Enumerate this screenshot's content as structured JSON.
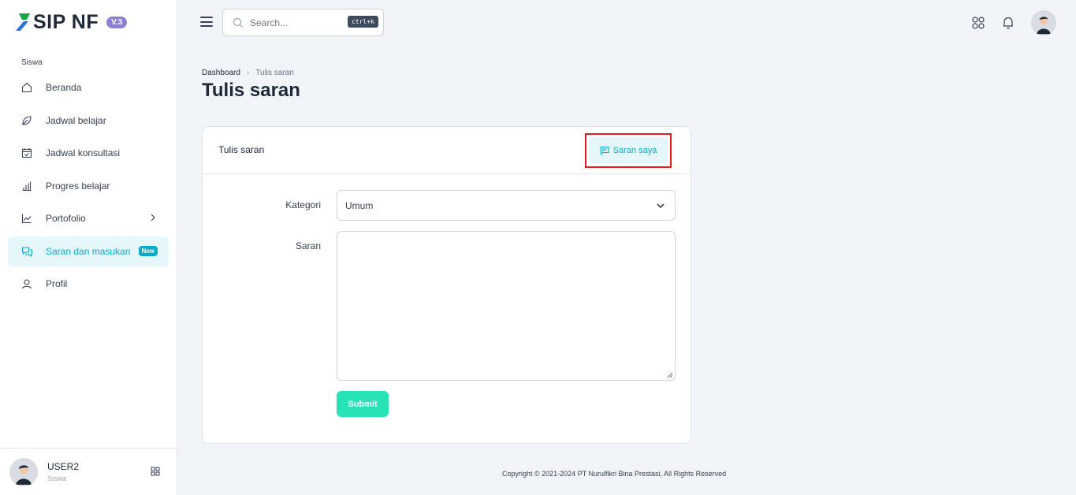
{
  "brand": {
    "name": "SIP NF",
    "version": "V.3"
  },
  "sidebar": {
    "section_label": "Siswa",
    "items": [
      {
        "label": "Beranda",
        "icon": "home-icon"
      },
      {
        "label": "Jadwal belajar",
        "icon": "leaf-icon"
      },
      {
        "label": "Jadwal konsultasi",
        "icon": "calendar-check-icon"
      },
      {
        "label": "Progres belajar",
        "icon": "bar-chart-icon"
      },
      {
        "label": "Portofolio",
        "icon": "trend-chart-icon"
      },
      {
        "label": "Saran dan masukan",
        "icon": "chat-bubbles-icon",
        "badge": "New"
      },
      {
        "label": "Profil",
        "icon": "user-icon"
      }
    ]
  },
  "user": {
    "name": "USER2",
    "role": "Siswa"
  },
  "topbar": {
    "search_placeholder": "Search...",
    "shortcut": "ctrl+k"
  },
  "breadcrumb": {
    "root": "Dashboard",
    "current": "Tulis saran"
  },
  "page": {
    "title": "Tulis saran"
  },
  "card": {
    "title": "Tulis saran",
    "action_label": "Saran saya",
    "kategori_label": "Kategori",
    "kategori_value": "Umum",
    "saran_label": "Saran",
    "submit_label": "Submit"
  },
  "footer": {
    "copyright": "Copyright © 2021-2024 PT Nurulfikri Bina Prestasi, All Rights Reserved"
  },
  "colors": {
    "accent": "#0aa9c9",
    "submit": "#27e3b6",
    "version_badge": "#8b7fd6",
    "highlight_border": "#e11d1d"
  }
}
